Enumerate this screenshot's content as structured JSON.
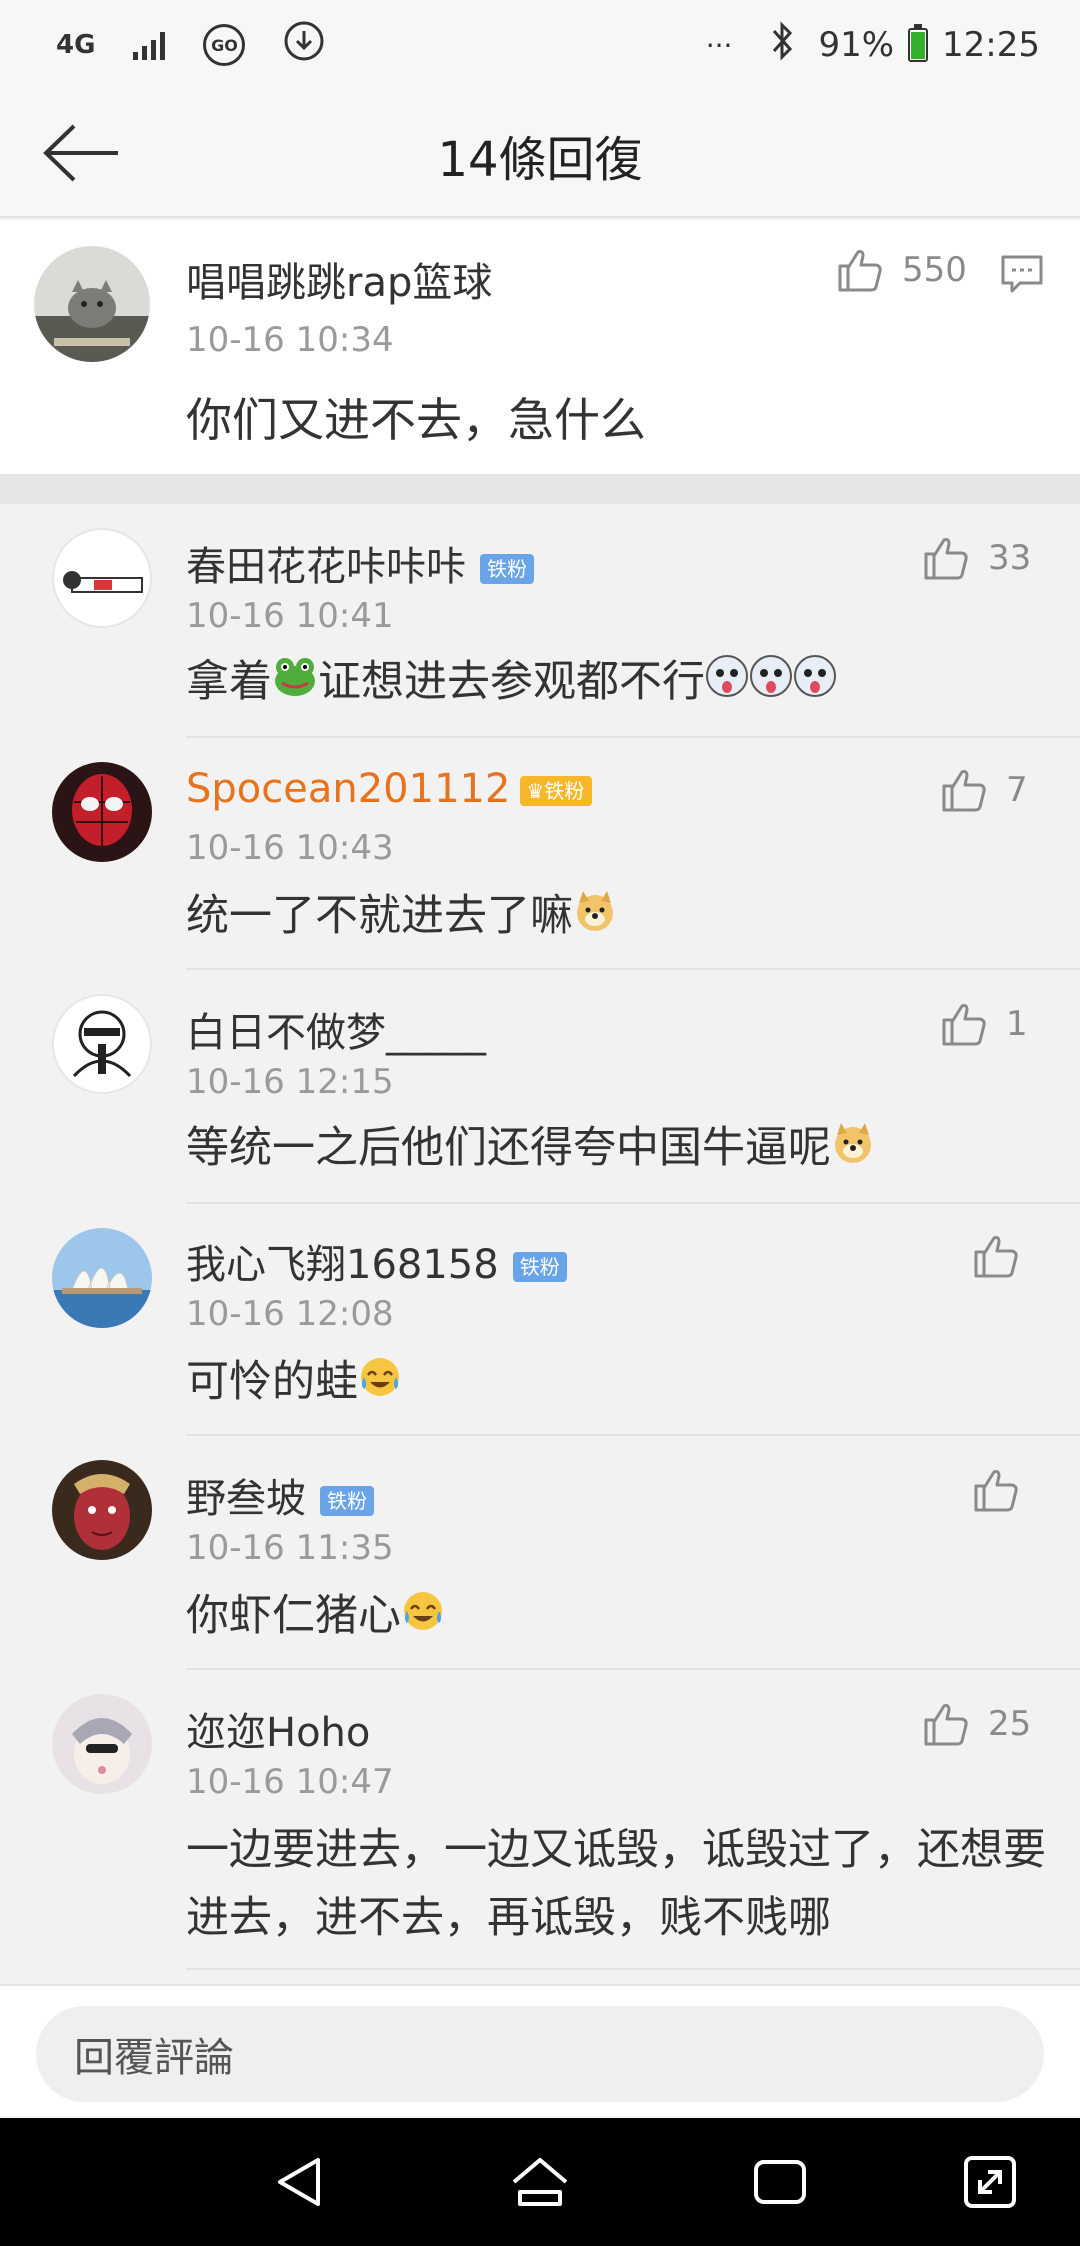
{
  "status_bar": {
    "network": "4G",
    "go_label": "GO",
    "more": "···",
    "battery_percent": "91%",
    "battery_level": 0.91,
    "time": "12:25"
  },
  "header": {
    "title": "14條回復"
  },
  "main_comment": {
    "author": "唱唱跳跳rap篮球",
    "time": "10-16 10:34",
    "text": "你们又进不去，急什么",
    "likes": "550"
  },
  "replies": [
    {
      "author": "春田花花咔咔咔",
      "badge": "铁粉",
      "time": "10-16 10:41",
      "text_a": "拿着",
      "text_b": "证想进去参观都不行",
      "likes": "33"
    },
    {
      "author": "Spocean201112",
      "badge": "铁粉",
      "time": "10-16 10:43",
      "text": "统一了不就进去了嘛",
      "likes": "7"
    },
    {
      "author": "白日不做梦_____",
      "time": "10-16 12:15",
      "text": "等统一之后他们还得夸中国牛逼呢",
      "likes": "1"
    },
    {
      "author": "我心飞翔168158",
      "badge": "铁粉",
      "time": "10-16 12:08",
      "text": "可怜的蛙",
      "likes": ""
    },
    {
      "author": "野叁坡",
      "badge": "铁粉",
      "time": "10-16 11:35",
      "text": "你虾仁猪心",
      "likes": ""
    },
    {
      "author": "迩迩Hoho",
      "time": "10-16 10:47",
      "text": "一边要进去，一边又诋毁，诋毁过了，还想要进去，进不去，再诋毁，贱不贱哪",
      "likes": "25"
    }
  ],
  "footer": {
    "reply_placeholder": "回覆評論"
  },
  "colors": {
    "accent_orange": "#e8731c",
    "fan_badge": "#6aa4e8",
    "gold_badge": "#f6b72a",
    "battery_green": "#35b02c"
  }
}
